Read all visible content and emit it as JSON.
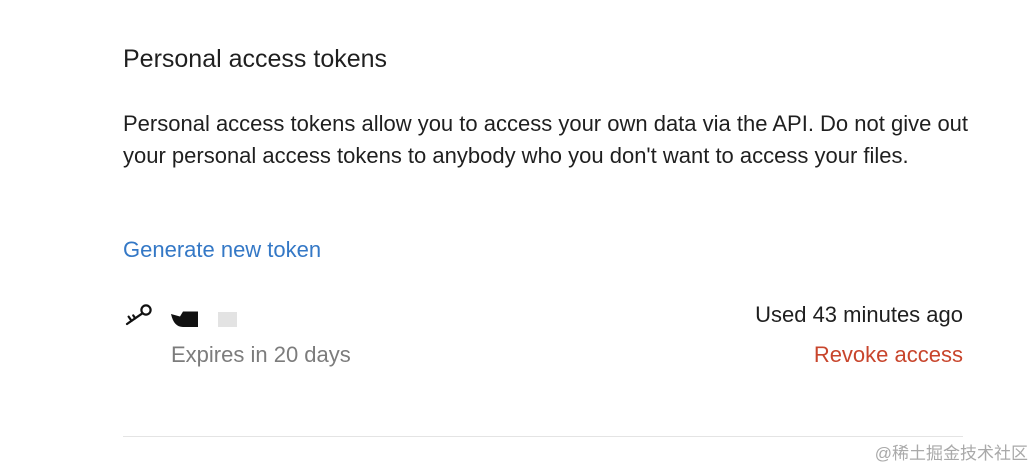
{
  "section": {
    "title": "Personal access tokens",
    "description": "Personal access tokens allow you to access your own data via the API. Do not give out your personal access tokens to anybody who you don't want to access your files.",
    "generate_link_label": "Generate new token"
  },
  "tokens": [
    {
      "icon": "key-icon",
      "name_redacted": true,
      "expires_text": "Expires in 20 days",
      "last_used_text": "Used 43 minutes ago",
      "revoke_label": "Revoke access"
    }
  ],
  "watermark": "@稀土掘金技术社区",
  "colors": {
    "link": "#3478c6",
    "danger": "#c8452c",
    "muted_text": "#7c7c7c",
    "primary_text": "#1f1f1f",
    "divider": "#e4e4e4"
  }
}
